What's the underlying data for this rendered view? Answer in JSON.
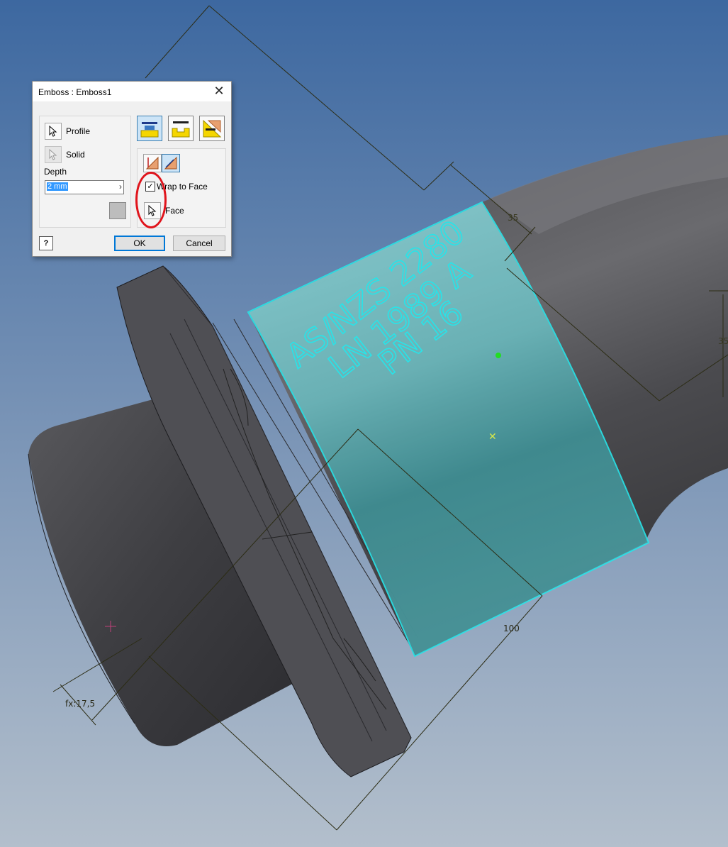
{
  "dialog": {
    "title": "Emboss : Emboss1",
    "close_label": "✕",
    "profile_label": "Profile",
    "solid_label": "Solid",
    "depth_label": "Depth",
    "depth_value": "2 mm",
    "wrap_to_face_label": "Wrap to Face",
    "wrap_to_face_checked": true,
    "face_label": "Face",
    "ok_label": "OK",
    "cancel_label": "Cancel",
    "help_label": "?"
  },
  "viewport": {
    "emboss_lines": [
      "AS/NZS 2280",
      "LN 1989 A",
      "PN 16"
    ],
    "dim_35_top": "35",
    "dim_35_right": "35",
    "dim_100": "100",
    "dim_fx": "fx:17,5"
  },
  "colors": {
    "accent_cyan": "#29e3e8",
    "highlight_red": "#e0141c",
    "background_top": "#3d68a0",
    "background_bottom": "#a9b6c6"
  }
}
